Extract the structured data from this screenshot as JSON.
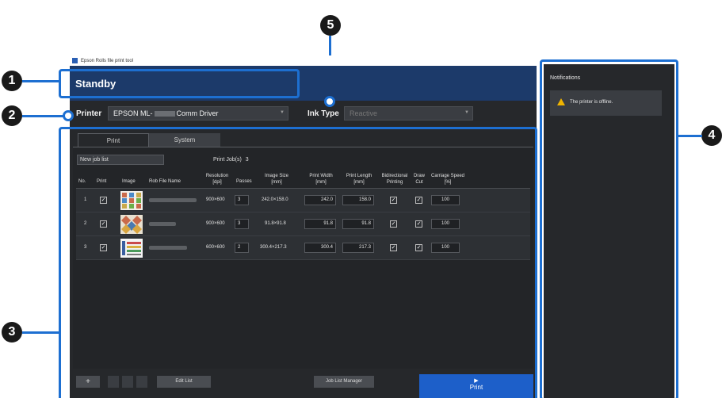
{
  "window": {
    "title": "Epson Rolls file print tool"
  },
  "status": {
    "text": "Standby"
  },
  "printer": {
    "label": "Printer",
    "value_prefix": "EPSON ML-",
    "value_suffix": "Comm Driver"
  },
  "ink": {
    "label": "Ink Type",
    "value": "Reactive"
  },
  "tabs": [
    {
      "label": "Print"
    },
    {
      "label": "System"
    }
  ],
  "joblist": {
    "selected": "New job list",
    "count_label": "Print Job(s)",
    "count": "3"
  },
  "table": {
    "headers": {
      "no": "No.",
      "print": "Print",
      "image": "Image",
      "file": "Rob File Name",
      "resolution": "Resolution\n[dpi]",
      "passes": "Passes",
      "image_size": "Image Size\n[mm]",
      "print_width": "Print Width\n[mm]",
      "print_length": "Print Length\n[mm]",
      "bidirectional": "Bidirectional\nPrinting",
      "draw_cut": "Draw\nCut",
      "carriage": "Carriage Speed\n[%]"
    },
    "rows": [
      {
        "no": "1",
        "resolution": "900×600",
        "passes": "3",
        "image_size": "242.0×158.0",
        "print_width": "242.0",
        "print_length": "158.0",
        "speed": "100"
      },
      {
        "no": "2",
        "resolution": "900×600",
        "passes": "3",
        "image_size": "91.8×91.8",
        "print_width": "91.8",
        "print_length": "91.8",
        "speed": "100"
      },
      {
        "no": "3",
        "resolution": "600×600",
        "passes": "2",
        "image_size": "300.4×217.3",
        "print_width": "300.4",
        "print_length": "217.3",
        "speed": "100"
      }
    ]
  },
  "buttons": {
    "add": "+",
    "edit_list": "Edit List",
    "job_list_manager": "Job List Manager",
    "print": "Print"
  },
  "notifications": {
    "title": "Notifications",
    "items": [
      {
        "message": "The printer is offline."
      }
    ]
  },
  "callouts": [
    "1",
    "2",
    "3",
    "4",
    "5"
  ],
  "colors": {
    "accent": "#1d6fd1",
    "status_bar": "#1c3a6a",
    "print_button": "#1d5fc9",
    "warning": "#f0b400"
  }
}
